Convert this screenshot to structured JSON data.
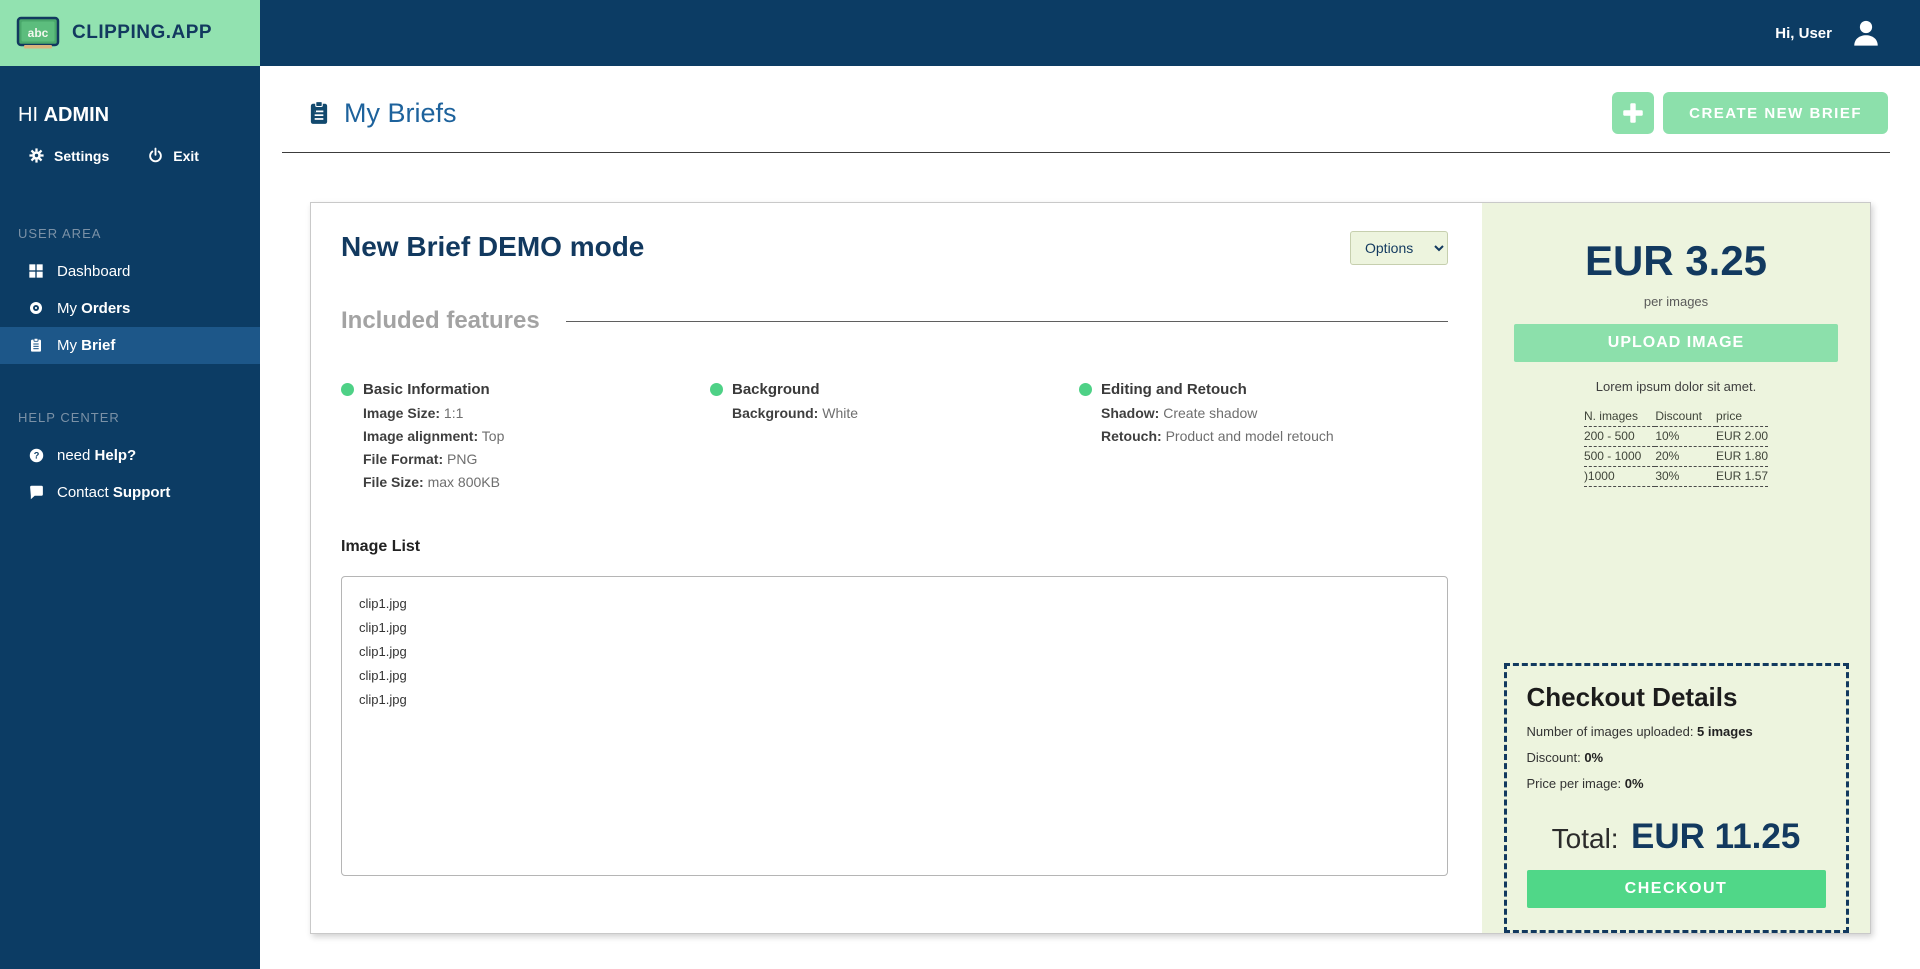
{
  "brand": {
    "name": "CLIPPING.APP",
    "logo_letters": "abc"
  },
  "topbar": {
    "greeting": "Hi, User"
  },
  "sidebar": {
    "greeting": {
      "prefix": "HI ",
      "bold": "ADMIN"
    },
    "actions": {
      "settings": {
        "label": "Settings",
        "icon": "gear-icon"
      },
      "exit": {
        "label": "Exit",
        "icon": "power-icon"
      }
    },
    "user_area": {
      "title": "USER AREA",
      "items": [
        {
          "text": "Dashboard",
          "bold": "",
          "icon": "grid-icon"
        },
        {
          "text": "My ",
          "bold": "Orders",
          "icon": "disc-icon"
        },
        {
          "text": "My ",
          "bold": "Brief",
          "icon": "clipboard-icon"
        }
      ]
    },
    "help_center": {
      "title": "HELP CENTER",
      "items": [
        {
          "text": "need ",
          "bold": "Help?",
          "icon": "question-circle-icon"
        },
        {
          "text": "Contact ",
          "bold": "Support",
          "icon": "chat-bubble-icon"
        }
      ]
    }
  },
  "page": {
    "title": "My Briefs",
    "title_icon": "clipboard-icon",
    "create_button": "CREATE NEW BRIEF",
    "plus_button_icon": "plus-icon"
  },
  "brief": {
    "title": "New Brief DEMO mode",
    "options_label": "Options",
    "features_heading": "Included features",
    "features": [
      {
        "title": "Basic Information",
        "details": [
          {
            "label": "Image Size:",
            "value": "1:1"
          },
          {
            "label": "Image alignment:",
            "value": "Top"
          },
          {
            "label": "File Format:",
            "value": "PNG"
          },
          {
            "label": "File Size:",
            "value": "max 800KB"
          }
        ]
      },
      {
        "title": "Background",
        "details": [
          {
            "label": "Background:",
            "value": "White"
          }
        ]
      },
      {
        "title": "Editing and Retouch",
        "details": [
          {
            "label": "Shadow:",
            "value": "Create shadow"
          },
          {
            "label": "Retouch:",
            "value": "Product and model retouch"
          }
        ]
      }
    ],
    "image_list": {
      "heading": "Image List",
      "items": [
        "clip1.jpg",
        "clip1.jpg",
        "clip1.jpg",
        "clip1.jpg",
        "clip1.jpg"
      ]
    }
  },
  "pricing_panel": {
    "price": "EUR 3.25",
    "price_caption": "per images",
    "upload_button": "UPLOAD IMAGE",
    "note": "Lorem ipsum dolor sit amet.",
    "table": {
      "headers": [
        "N. images",
        "Discount",
        "price"
      ],
      "rows": [
        [
          "200 - 500",
          "10%",
          "EUR 2.00"
        ],
        [
          "500 - 1000",
          "20%",
          "EUR 1.80"
        ],
        [
          ")1000",
          "30%",
          "EUR 1.57"
        ]
      ]
    },
    "checkout": {
      "heading": "Checkout Details",
      "lines": [
        {
          "label": "Number of images uploaded: ",
          "value": "5 images"
        },
        {
          "label": "Discount: ",
          "value": "0%"
        },
        {
          "label": "Price per image: ",
          "value": "0%"
        }
      ],
      "total_label": "Total:",
      "total_value": "EUR 11.25",
      "checkout_button": "CHECKOUT"
    }
  },
  "colors": {
    "navy": "#0c3c64",
    "navy_dark_text": "#12395f",
    "brand_green": "#92e2b0",
    "button_green": "#8ce0ab",
    "checkout_green": "#50d788",
    "dot_green": "#4ed186",
    "panel_bg": "#edf4de",
    "heading_blue": "#1d629c",
    "active_item_bg": "#1d5789"
  }
}
